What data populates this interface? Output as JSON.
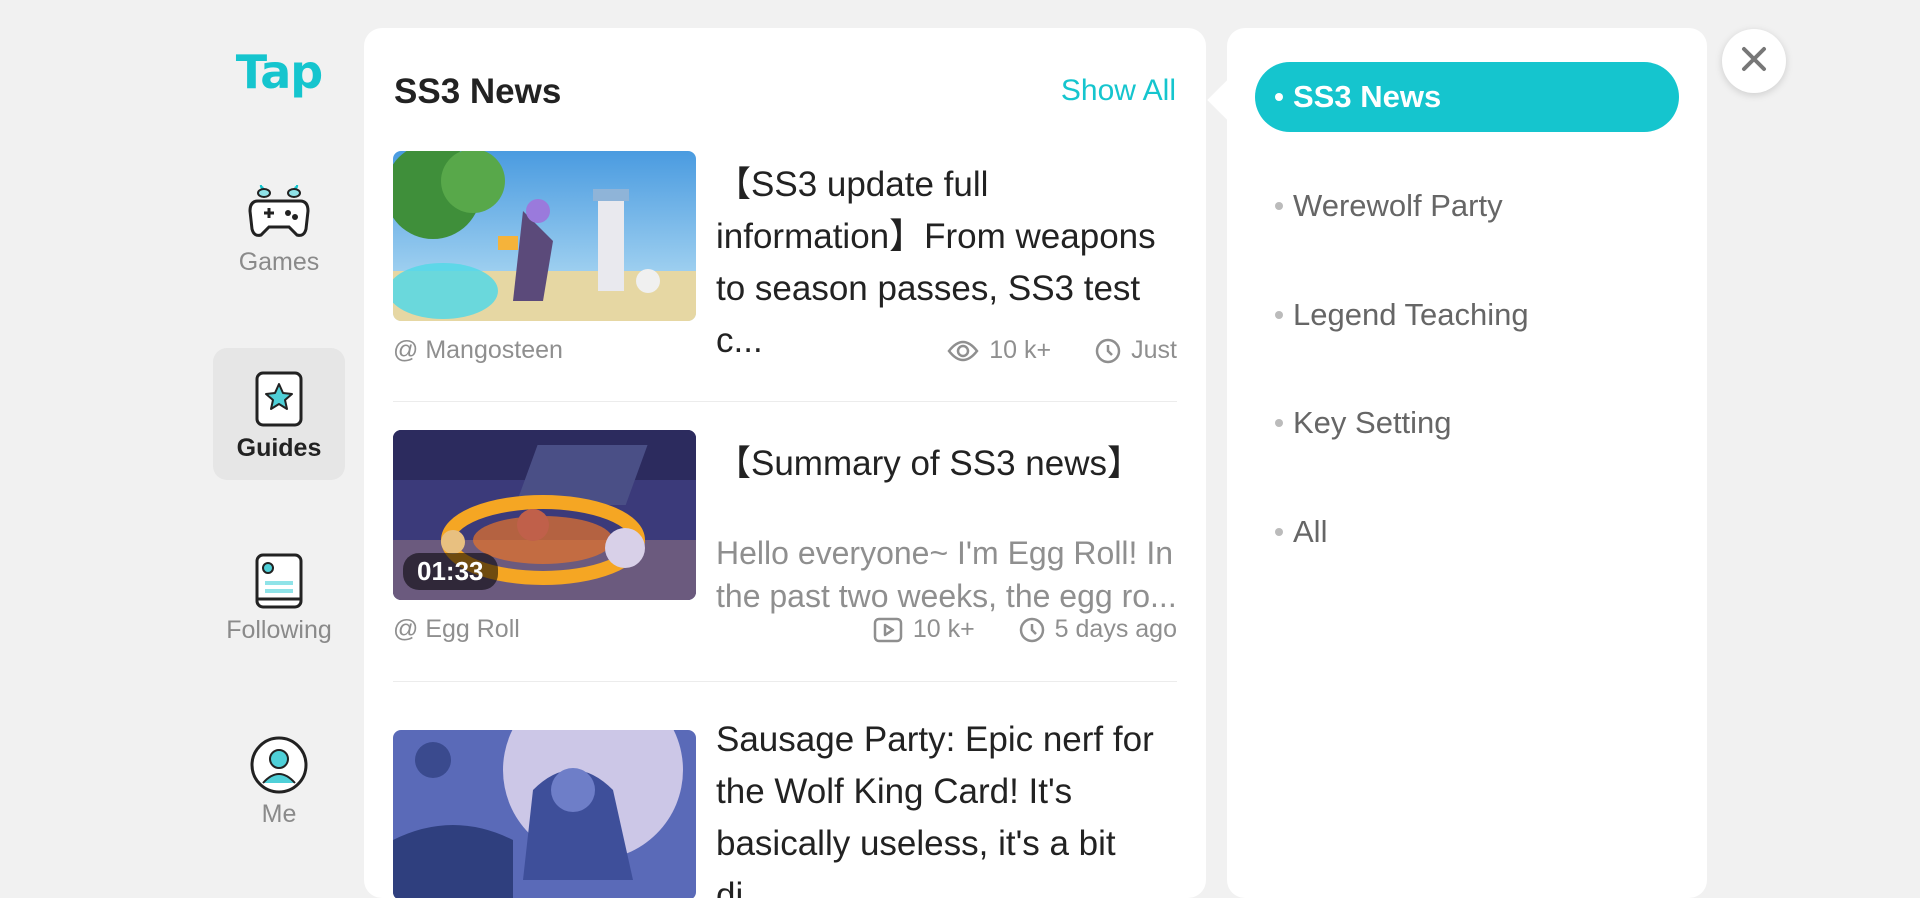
{
  "app": {
    "logo_text": "Tap"
  },
  "nav": {
    "items": [
      {
        "label": "Games",
        "icon": "gamepad-icon"
      },
      {
        "label": "Guides",
        "icon": "guide-card-icon",
        "active": true
      },
      {
        "label": "Following",
        "icon": "feed-icon"
      },
      {
        "label": "Me",
        "icon": "user-icon"
      }
    ]
  },
  "news": {
    "title": "SS3 News",
    "show_all": "Show All",
    "articles": [
      {
        "title": "【SS3 update full information】From weapons to season passes, SS3 test c...",
        "author": "@ Mangosteen",
        "views": "10 k+",
        "time": "Just"
      },
      {
        "title": "【Summary of SS3 news】",
        "description": "Hello everyone~ I'm Egg Roll! In the past two weeks, the egg ro...",
        "duration": "01:33",
        "author": "@ Egg Roll",
        "plays": "10 k+",
        "time": "5 days ago"
      },
      {
        "title": "Sausage Party: Epic nerf for the Wolf King Card!  It's basically useless, it's a bit di..."
      }
    ]
  },
  "categories": {
    "items": [
      {
        "label": "SS3 News",
        "active": true
      },
      {
        "label": "Werewolf Party"
      },
      {
        "label": "Legend Teaching"
      },
      {
        "label": "Key Setting"
      },
      {
        "label": "All"
      }
    ]
  },
  "colors": {
    "accent": "#15c5ce",
    "background": "#f1f1f1"
  }
}
